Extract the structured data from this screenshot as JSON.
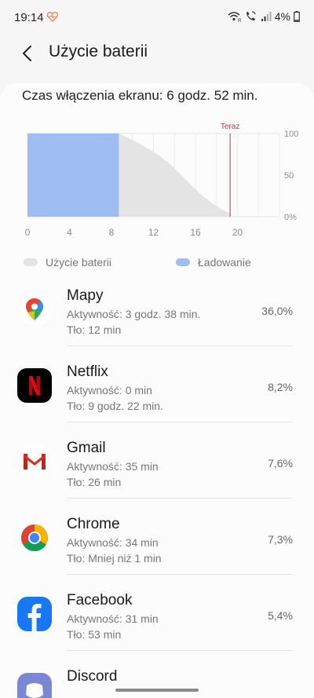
{
  "status": {
    "time": "19:14",
    "battery_text": "4%"
  },
  "header": {
    "title": "Użycie baterii"
  },
  "summary": {
    "screen_time": "Czas włączenia ekranu: 6 godz. 52 min."
  },
  "chart_data": {
    "type": "area",
    "now_label": "Teraz",
    "x_ticks": [
      "0",
      "4",
      "8",
      "12",
      "16",
      "20"
    ],
    "y_ticks": [
      "100",
      "50",
      "0%"
    ],
    "xlim": [
      0,
      24
    ],
    "ylim": [
      0,
      100
    ],
    "now_x": 19.3,
    "series": [
      {
        "name": "Użycie baterii",
        "color": "#e4e4e4",
        "x": [
          8.7,
          9.5,
          10.5,
          11.5,
          12.5,
          13.5,
          14.5,
          15.5,
          16.5,
          17.5,
          18.5,
          19.3
        ],
        "y": [
          100,
          95,
          89,
          82,
          74,
          64,
          52,
          39,
          27,
          17,
          9,
          4
        ]
      },
      {
        "name": "Ładowanie",
        "color": "#9dbdf3",
        "x_range": [
          0,
          8.7
        ],
        "y": 100
      }
    ]
  },
  "legend": {
    "usage_label": "Użycie baterii",
    "charging_label": "Ładowanie",
    "usage_color": "#e4e4e4",
    "charging_color": "#9dbdf3"
  },
  "apps": [
    {
      "name": "Mapy",
      "active": "Aktywność: 3 godz. 38 min.",
      "background": "Tło: 12 min",
      "percent": "36,0%",
      "icon": "google-maps-icon"
    },
    {
      "name": "Netflix",
      "active": "Aktywność: 0 min",
      "background": "Tło: 9 godz. 22 min.",
      "percent": "8,2%",
      "icon": "netflix-icon"
    },
    {
      "name": "Gmail",
      "active": "Aktywność: 35 min",
      "background": "Tło: 26 min",
      "percent": "7,6%",
      "icon": "gmail-icon"
    },
    {
      "name": "Chrome",
      "active": "Aktywność: 34 min",
      "background": "Tło: Mniej niż 1 min",
      "percent": "7,3%",
      "icon": "chrome-icon"
    },
    {
      "name": "Facebook",
      "active": "Aktywność: 31 min",
      "background": "Tło: 53 min",
      "percent": "5,4%",
      "icon": "facebook-icon"
    },
    {
      "name": "Discord",
      "active": "",
      "background": "",
      "percent": "",
      "icon": "discord-icon"
    }
  ]
}
